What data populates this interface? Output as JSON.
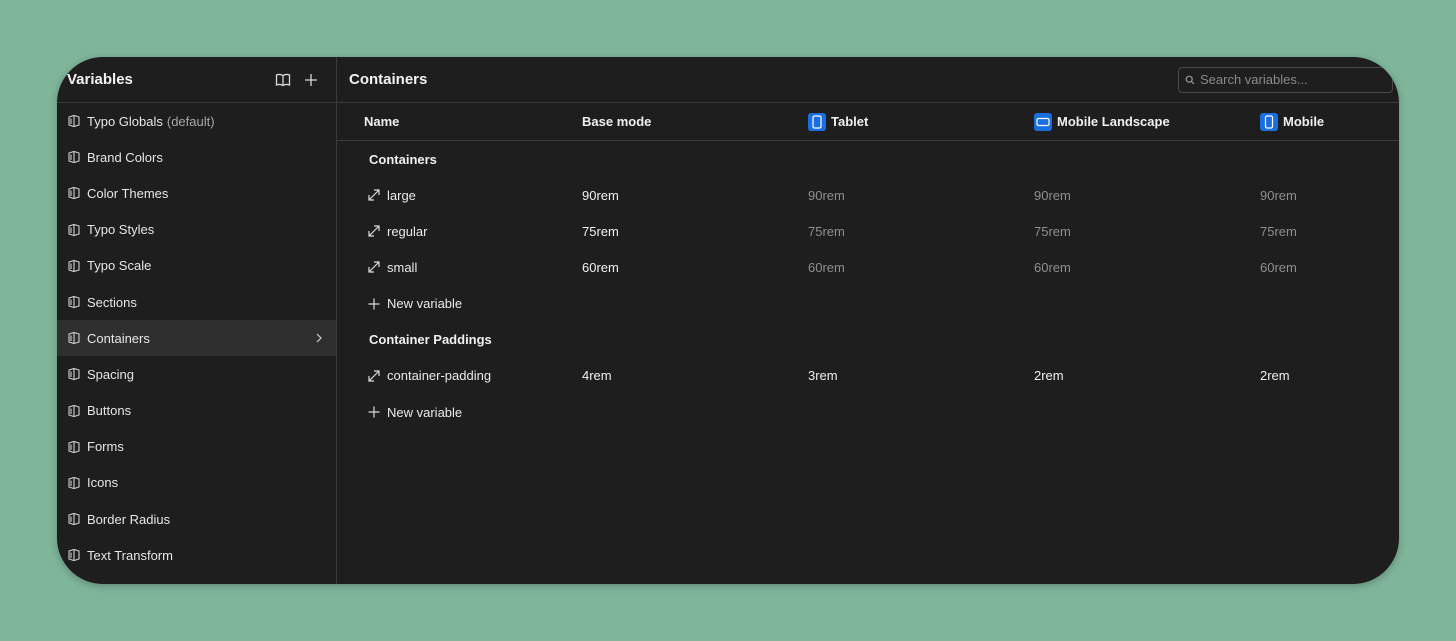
{
  "sidebar": {
    "title": "Variables",
    "items": [
      {
        "label": "Typo Globals",
        "suffix": "(default)"
      },
      {
        "label": "Brand Colors"
      },
      {
        "label": "Color Themes"
      },
      {
        "label": "Typo Styles"
      },
      {
        "label": "Typo Scale"
      },
      {
        "label": "Sections"
      },
      {
        "label": "Containers",
        "active": true
      },
      {
        "label": "Spacing"
      },
      {
        "label": "Buttons"
      },
      {
        "label": "Forms"
      },
      {
        "label": "Icons"
      },
      {
        "label": "Border Radius"
      },
      {
        "label": "Text Transform"
      }
    ]
  },
  "main": {
    "title": "Containers",
    "search_placeholder": "Search variables...",
    "columns": {
      "name": "Name",
      "base": "Base mode",
      "tablet": "Tablet",
      "mobile_landscape": "Mobile Landscape",
      "mobile": "Mobile"
    },
    "groups": [
      {
        "title": "Containers",
        "rows": [
          {
            "name": "large",
            "base": "90rem",
            "tablet": "90rem",
            "mobile_landscape": "90rem",
            "mobile": "90rem"
          },
          {
            "name": "regular",
            "base": "75rem",
            "tablet": "75rem",
            "mobile_landscape": "75rem",
            "mobile": "75rem"
          },
          {
            "name": "small",
            "base": "60rem",
            "tablet": "60rem",
            "mobile_landscape": "60rem",
            "mobile": "60rem"
          }
        ],
        "new_label": "New variable"
      },
      {
        "title": "Container Paddings",
        "rows": [
          {
            "name": "container-padding",
            "base": "4rem",
            "tablet": "3rem",
            "mobile_landscape": "2rem",
            "mobile": "2rem"
          }
        ],
        "new_label": "New variable"
      }
    ]
  },
  "colors": {
    "accent_blue": "#1a6fe0",
    "background": "#1e1e1e",
    "page_bg": "#7fb59b"
  }
}
